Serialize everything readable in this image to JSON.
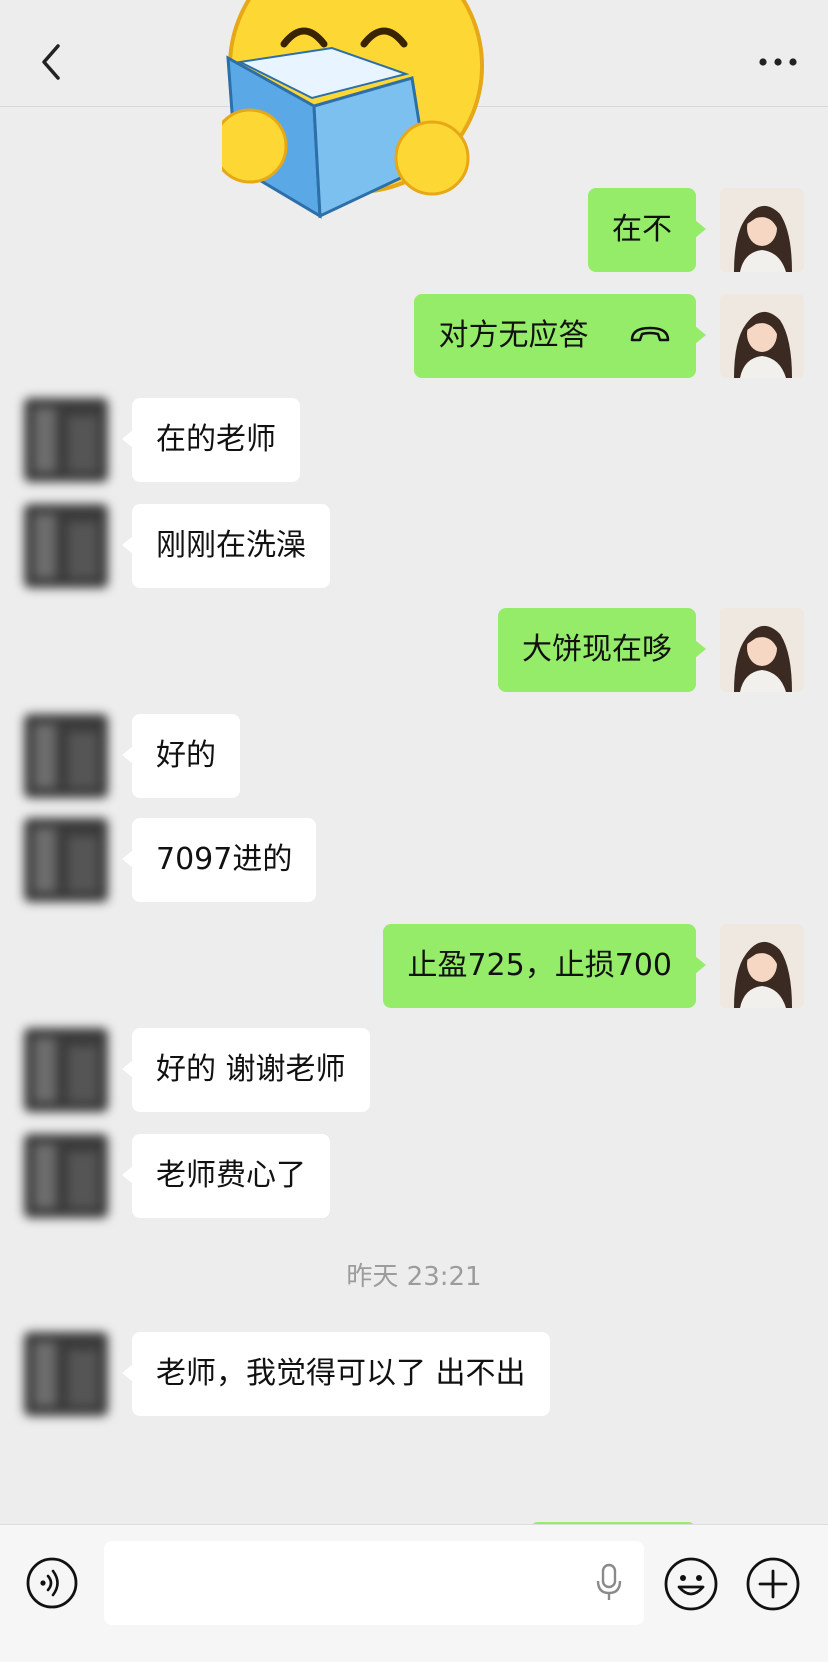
{
  "header": {
    "back_icon": "chevron-left-icon",
    "more_icon": "more-dots-icon",
    "sticker": "smiley-reading-book-sticker"
  },
  "messages": [
    {
      "side": "right",
      "text": "在不"
    },
    {
      "side": "right",
      "text": "对方无应答",
      "icon": "hang-up-phone-icon"
    },
    {
      "side": "left",
      "text": "在的老师"
    },
    {
      "side": "left",
      "text": "刚刚在洗澡"
    },
    {
      "side": "right",
      "text": "大饼现在哆"
    },
    {
      "side": "left",
      "text": "好的"
    },
    {
      "side": "left",
      "text": "7097进的"
    },
    {
      "side": "right",
      "text": "止盈725，止损700"
    },
    {
      "side": "left",
      "text": "好的 谢谢老师"
    },
    {
      "side": "left",
      "text": "老师费心了"
    },
    {
      "side": "left",
      "text": "老师，我觉得可以了 出不出"
    }
  ],
  "timestamp": "昨天 23:21",
  "composer": {
    "voice_icon": "voice-mode-icon",
    "mic_icon": "microphone-icon",
    "emoji_icon": "emoji-icon",
    "plus_icon": "plus-icon"
  },
  "colors": {
    "background": "#ededed",
    "sent_bubble": "#95ec69",
    "received_bubble": "#ffffff",
    "timestamp_text": "#9c9c9c"
  }
}
